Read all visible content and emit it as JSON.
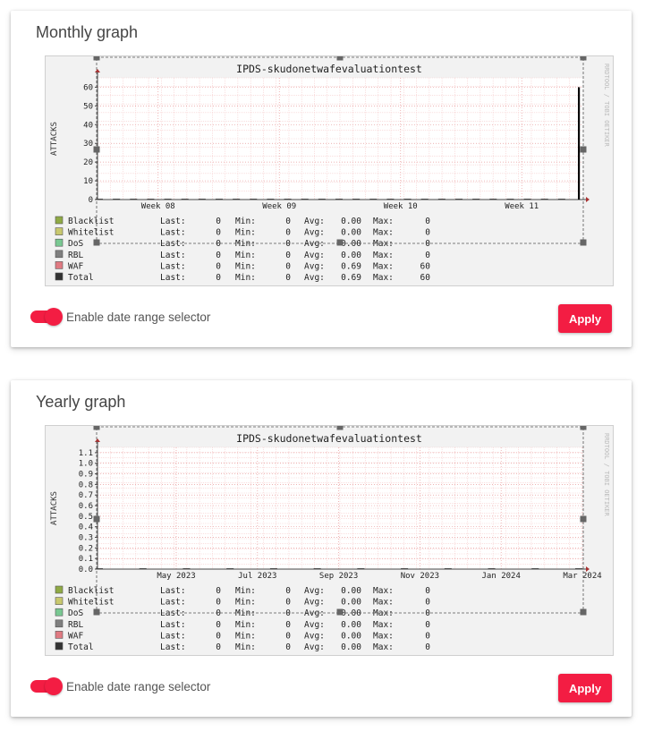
{
  "controls": {
    "toggle_label": "Enable date range selector",
    "apply_label": "Apply"
  },
  "colors": {
    "accent": "#f31d43",
    "grid": "#f2b8b8",
    "handle": "#666666"
  },
  "chart_data": [
    {
      "type": "line",
      "card_title": "Monthly graph",
      "title": "IPDS-skudonetwafevaluationtest",
      "ylabel": "ATTACKS",
      "watermark": "RRDTOOL / TOBI OETIKER",
      "ylim": [
        0,
        65
      ],
      "yticks": [
        "0",
        "10",
        "20",
        "30",
        "40",
        "50",
        "60"
      ],
      "xticks": [
        "Week 08",
        "Week 09",
        "Week 10",
        "Week 11"
      ],
      "series": [
        {
          "name": "Total",
          "color": "#000000",
          "values": [
            0,
            0,
            0,
            0,
            0,
            0,
            0,
            0,
            0,
            0,
            0,
            0,
            0,
            0,
            0,
            0,
            0,
            0,
            0,
            0,
            0,
            0,
            0,
            0,
            0,
            0,
            0,
            0,
            60
          ]
        }
      ],
      "legend": [
        {
          "name": "Blacklist",
          "color": "#8faa45",
          "last": "0",
          "min": "0",
          "avg": "0.00",
          "max": "0"
        },
        {
          "name": "Whitelist",
          "color": "#c8c86e",
          "last": "0",
          "min": "0",
          "avg": "0.00",
          "max": "0"
        },
        {
          "name": "DoS",
          "color": "#79c892",
          "last": "0",
          "min": "0",
          "avg": "0.00",
          "max": "0"
        },
        {
          "name": "RBL",
          "color": "#7f7f7f",
          "last": "0",
          "min": "0",
          "avg": "0.00",
          "max": "0"
        },
        {
          "name": "WAF",
          "color": "#e07a82",
          "last": "0",
          "min": "0",
          "avg": "0.69",
          "max": "60"
        },
        {
          "name": "Total",
          "color": "#333333",
          "last": "0",
          "min": "0",
          "avg": "0.69",
          "max": "60"
        }
      ]
    },
    {
      "type": "line",
      "card_title": "Yearly graph",
      "title": "IPDS-skudonetwafevaluationtest",
      "ylabel": "ATTACKS",
      "watermark": "RRDTOOL / TOBI OETIKER",
      "ylim": [
        0,
        1.15
      ],
      "yticks": [
        "0.0",
        "0.1",
        "0.2",
        "0.3",
        "0.4",
        "0.5",
        "0.6",
        "0.7",
        "0.8",
        "0.9",
        "1.0",
        "1.1"
      ],
      "xticks": [
        "May 2023",
        "Jul 2023",
        "Sep 2023",
        "Nov 2023",
        "Jan 2024",
        "Mar 2024"
      ],
      "series": [
        {
          "name": "Total",
          "color": "#000000",
          "values": [
            0,
            0,
            0,
            0,
            0,
            0,
            0,
            0,
            0,
            0,
            0,
            0
          ]
        }
      ],
      "legend": [
        {
          "name": "Blacklist",
          "color": "#8faa45",
          "last": "0",
          "min": "0",
          "avg": "0.00",
          "max": "0"
        },
        {
          "name": "Whitelist",
          "color": "#c8c86e",
          "last": "0",
          "min": "0",
          "avg": "0.00",
          "max": "0"
        },
        {
          "name": "DoS",
          "color": "#79c892",
          "last": "0",
          "min": "0",
          "avg": "0.00",
          "max": "0"
        },
        {
          "name": "RBL",
          "color": "#7f7f7f",
          "last": "0",
          "min": "0",
          "avg": "0.00",
          "max": "0"
        },
        {
          "name": "WAF",
          "color": "#e07a82",
          "last": "0",
          "min": "0",
          "avg": "0.00",
          "max": "0"
        },
        {
          "name": "Total",
          "color": "#333333",
          "last": "0",
          "min": "0",
          "avg": "0.00",
          "max": "0"
        }
      ]
    }
  ]
}
